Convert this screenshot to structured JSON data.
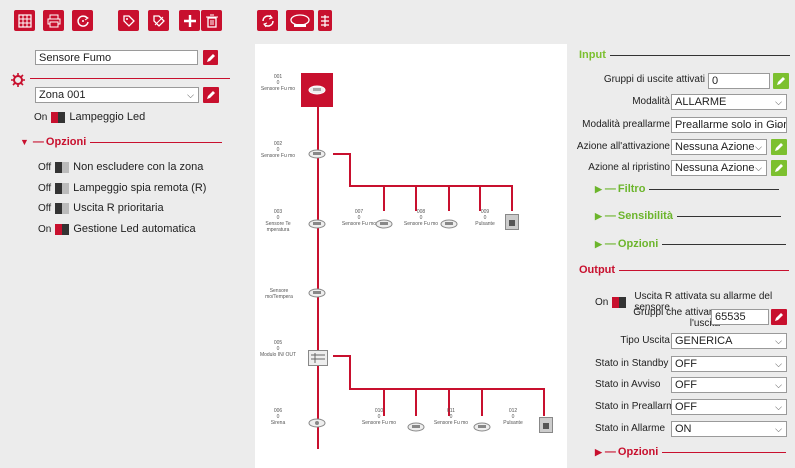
{
  "toolbar": {
    "buttons": [
      {
        "name": "grid-icon"
      },
      {
        "name": "printer-icon"
      },
      {
        "name": "refresh-scan-icon"
      },
      {
        "name": "tag-add-icon"
      },
      {
        "name": "tag-remove-icon"
      },
      {
        "name": "plus-icon"
      },
      {
        "name": "trash-icon"
      },
      {
        "name": "sync-icon"
      },
      {
        "name": "device-add-icon"
      },
      {
        "name": "sort-icon"
      }
    ]
  },
  "left": {
    "device_name": "Sensore Fumo",
    "zone": "Zona 001",
    "led_toggle": {
      "state": "On",
      "label": "Lampeggio Led"
    },
    "options_title": "Opzioni",
    "options": [
      {
        "state": "Off",
        "label": "Non escludere con la zona"
      },
      {
        "state": "Off",
        "label": "Lampeggio spia remota (R)"
      },
      {
        "state": "Off",
        "label": "Uscita R prioritaria"
      },
      {
        "state": "On",
        "label": "Gestione Led automatica"
      }
    ]
  },
  "diagram": {
    "nodes": [
      {
        "id": "001",
        "n": "0",
        "name": "Sensore Fu mo"
      },
      {
        "id": "002",
        "n": "0",
        "name": "Sensore Fu mo"
      },
      {
        "id": "003",
        "n": "0",
        "name": "Sensore Te mperatura"
      },
      {
        "id": "007",
        "n": "0",
        "name": "Sensore Fu mo"
      },
      {
        "id": "008",
        "n": "0",
        "name": "Sensore Fu mo"
      },
      {
        "id": "009",
        "n": "0",
        "name": "Pulsante"
      },
      {
        "id": "",
        "n": "",
        "name": "Sensore mo/Tempera"
      },
      {
        "id": "005",
        "n": "0",
        "name": "Modulo IN/ OUT"
      },
      {
        "id": "006",
        "n": "0",
        "name": "Sirena"
      },
      {
        "id": "010",
        "n": "0",
        "name": "Sensore Fu mo"
      },
      {
        "id": "011",
        "n": "0",
        "name": "Sensore Fu mo"
      },
      {
        "id": "012",
        "n": "0",
        "name": "Pulsante"
      }
    ]
  },
  "input": {
    "title": "Input",
    "gruppi_label": "Gruppi di uscite attivati",
    "gruppi_value": "0",
    "modalita_label": "Modalità",
    "modalita_value": "ALLARME",
    "preallarme_label": "Modalità preallarme",
    "preallarme_value": "Preallarme solo in Giorno",
    "azione_att_label": "Azione all'attivazione",
    "azione_att_value": "Nessuna Azione",
    "azione_rip_label": "Azione al ripristino",
    "azione_rip_value": "Nessuna Azione",
    "filtro": "Filtro",
    "sensibilita": "Sensibilità",
    "opzioni": "Opzioni"
  },
  "output": {
    "title": "Output",
    "toggle_state": "On",
    "toggle_label": "Uscita R attivata su allarme del sensore",
    "gruppi_label": "Gruppi che attivano l'uscita",
    "gruppi_value": "65535",
    "tipo_label": "Tipo Uscita",
    "tipo_value": "GENERICA",
    "standby_label": "Stato in Standby",
    "standby_value": "OFF",
    "avviso_label": "Stato in Avviso",
    "avviso_value": "OFF",
    "preallarme_label": "Stato in Preallarme",
    "preallarme_value": "OFF",
    "allarme_label": "Stato in Allarme",
    "allarme_value": "ON",
    "opzioni": "Opzioni"
  },
  "colors": {
    "accent": "#c8102e",
    "green": "#7cc02f"
  }
}
